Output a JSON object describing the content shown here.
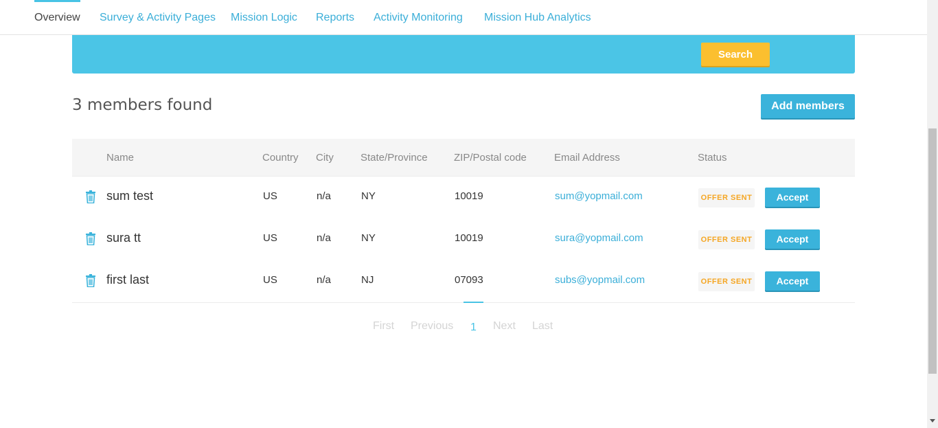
{
  "nav": {
    "tabs": [
      {
        "label": "Overview",
        "active": true
      },
      {
        "label": "Survey & Activity Pages"
      },
      {
        "label": "Mission Logic"
      },
      {
        "label": "Reports"
      },
      {
        "label": "Activity Monitoring"
      },
      {
        "label": "Mission Hub Analytics"
      }
    ]
  },
  "search": {
    "button_label": "Search"
  },
  "results": {
    "count_text": "3 members found",
    "add_button_label": "Add members"
  },
  "table": {
    "columns": {
      "name": "Name",
      "country": "Country",
      "city": "City",
      "state": "State/Province",
      "zip": "ZIP/Postal code",
      "email": "Email Address",
      "status": "Status"
    },
    "rows": [
      {
        "name": "sum test",
        "country": "US",
        "city": "n/a",
        "state": "NY",
        "zip": "10019",
        "email": "sum@yopmail.com",
        "status": "OFFER SENT",
        "action": "Accept"
      },
      {
        "name": "sura tt",
        "country": "US",
        "city": "n/a",
        "state": "NY",
        "zip": "10019",
        "email": "sura@yopmail.com",
        "status": "OFFER SENT",
        "action": "Accept"
      },
      {
        "name": "first last",
        "country": "US",
        "city": "n/a",
        "state": "NJ",
        "zip": "07093",
        "email": "subs@yopmail.com",
        "status": "OFFER SENT",
        "action": "Accept"
      }
    ]
  },
  "pagination": {
    "first": "First",
    "previous": "Previous",
    "current": "1",
    "next": "Next",
    "last": "Last"
  },
  "colors": {
    "accent": "#48c3e5",
    "search_button": "#fbbf2f",
    "status_text": "#f5a623",
    "link": "#3aaed8"
  },
  "icons": {
    "delete": "trash-icon"
  }
}
